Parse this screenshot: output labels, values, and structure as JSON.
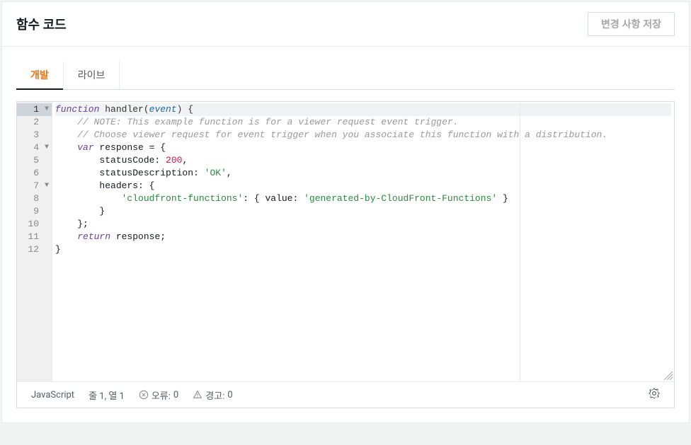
{
  "header": {
    "title": "함수 코드",
    "saveButton": "변경 사항 저장"
  },
  "tabs": {
    "dev": "개발",
    "live": "라이브"
  },
  "code": {
    "lines": [
      {
        "num": 1,
        "fold": "▼",
        "highlighted": true,
        "tokens": [
          {
            "t": "function",
            "c": "kw-storage"
          },
          {
            "t": " ",
            "c": ""
          },
          {
            "t": "handler",
            "c": "kw-name"
          },
          {
            "t": "(",
            "c": "kw-punct"
          },
          {
            "t": "event",
            "c": "kw-param"
          },
          {
            "t": ") {",
            "c": "kw-punct"
          }
        ]
      },
      {
        "num": 2,
        "fold": "",
        "tokens": [
          {
            "t": "    ",
            "c": ""
          },
          {
            "t": "// NOTE: This example function is for a viewer request event trigger.",
            "c": "kw-comment"
          }
        ]
      },
      {
        "num": 3,
        "fold": "",
        "tokens": [
          {
            "t": "    ",
            "c": ""
          },
          {
            "t": "// Choose viewer request for event trigger when you associate this function with a distribution.",
            "c": "kw-comment"
          }
        ]
      },
      {
        "num": 4,
        "fold": "▼",
        "tokens": [
          {
            "t": "    ",
            "c": ""
          },
          {
            "t": "var",
            "c": "kw-var"
          },
          {
            "t": " response = {",
            "c": ""
          }
        ]
      },
      {
        "num": 5,
        "fold": "",
        "tokens": [
          {
            "t": "        statusCode: ",
            "c": ""
          },
          {
            "t": "200",
            "c": "kw-num"
          },
          {
            "t": ",",
            "c": ""
          }
        ]
      },
      {
        "num": 6,
        "fold": "",
        "tokens": [
          {
            "t": "        statusDescription: ",
            "c": ""
          },
          {
            "t": "'OK'",
            "c": "kw-string"
          },
          {
            "t": ",",
            "c": ""
          }
        ]
      },
      {
        "num": 7,
        "fold": "▼",
        "tokens": [
          {
            "t": "        headers: {",
            "c": ""
          }
        ]
      },
      {
        "num": 8,
        "fold": "",
        "tokens": [
          {
            "t": "            ",
            "c": ""
          },
          {
            "t": "'cloudfront-functions'",
            "c": "kw-string"
          },
          {
            "t": ": { value: ",
            "c": ""
          },
          {
            "t": "'generated-by-CloudFront-Functions'",
            "c": "kw-string"
          },
          {
            "t": " }",
            "c": ""
          }
        ]
      },
      {
        "num": 9,
        "fold": "",
        "tokens": [
          {
            "t": "        }",
            "c": ""
          }
        ]
      },
      {
        "num": 10,
        "fold": "",
        "tokens": [
          {
            "t": "    };",
            "c": ""
          }
        ]
      },
      {
        "num": 11,
        "fold": "",
        "tokens": [
          {
            "t": "    ",
            "c": ""
          },
          {
            "t": "return",
            "c": "kw-return"
          },
          {
            "t": " response;",
            "c": ""
          }
        ]
      },
      {
        "num": 12,
        "fold": "",
        "tokens": [
          {
            "t": "}",
            "c": ""
          }
        ]
      }
    ]
  },
  "statusBar": {
    "language": "JavaScript",
    "position": "줄 1, 열 1",
    "errorsLabel": "오류:",
    "errorsCount": "0",
    "warningsLabel": "경고:",
    "warningsCount": "0"
  }
}
